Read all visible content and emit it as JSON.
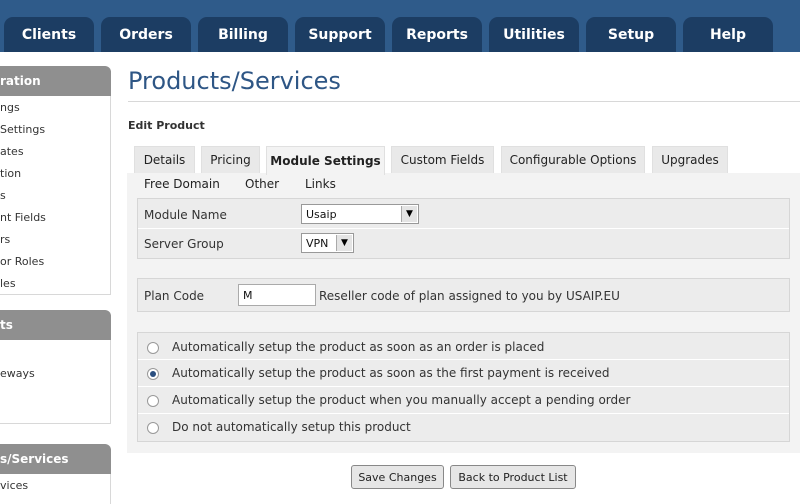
{
  "nav": {
    "tabs": [
      "Clients",
      "Orders",
      "Billing",
      "Support",
      "Reports",
      "Utilities",
      "Setup",
      "Help"
    ]
  },
  "sidebar": {
    "sections": [
      {
        "title": "ration",
        "items": [
          "ngs",
          "Settings",
          "ates",
          "tion",
          "s",
          "nt Fields",
          "rs",
          "or Roles",
          "les"
        ]
      },
      {
        "title": "ts",
        "items": [
          "eways"
        ]
      },
      {
        "title": "s/Services",
        "items": [
          "vices"
        ]
      }
    ]
  },
  "page": {
    "title": "Products/Services",
    "subtitle": "Edit Product"
  },
  "tabs": {
    "row1": [
      "Details",
      "Pricing",
      "Module Settings",
      "Custom Fields",
      "Configurable Options",
      "Upgrades"
    ],
    "row2": [
      "Free Domain",
      "Other",
      "Links"
    ],
    "active": "Module Settings"
  },
  "module": {
    "name_label": "Module Name",
    "name_value": "Usaip",
    "group_label": "Server Group",
    "group_value": "VPN"
  },
  "plan": {
    "label": "Plan Code",
    "value": "M",
    "description": "Reseller code of plan assigned to you by USAIP.EU"
  },
  "setup_options": [
    {
      "label": "Automatically setup the product as soon as an order is placed",
      "checked": false
    },
    {
      "label": "Automatically setup the product as soon as the first payment is received",
      "checked": true
    },
    {
      "label": "Automatically setup the product when you manually accept a pending order",
      "checked": false
    },
    {
      "label": "Do not automatically setup this product",
      "checked": false
    }
  ],
  "buttons": {
    "save": "Save Changes",
    "back": "Back to Product List"
  }
}
